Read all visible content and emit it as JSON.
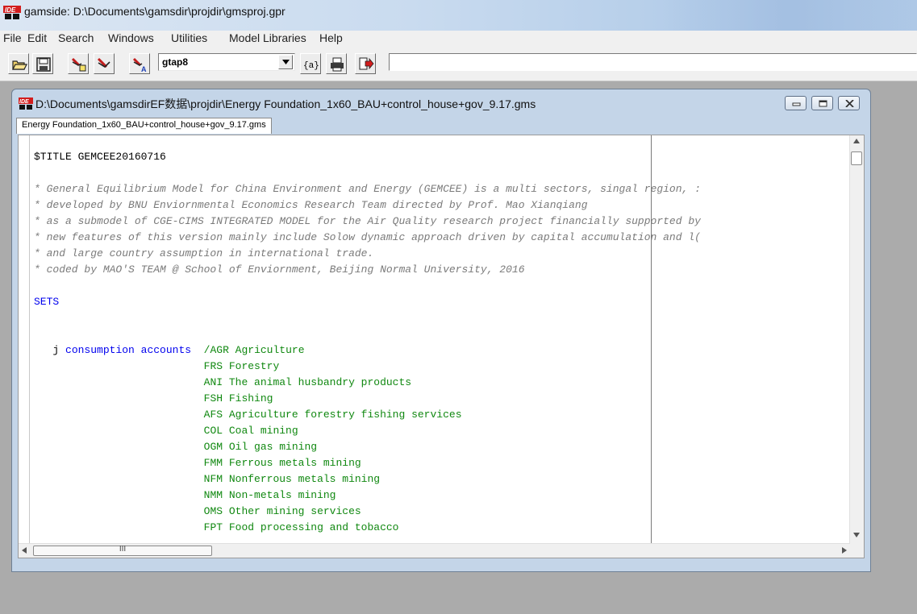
{
  "window": {
    "title": "gamside: D:\\Documents\\gamsdir\\projdir\\gmsproj.gpr"
  },
  "menu": [
    "File",
    "Edit",
    "Search",
    "Windows",
    "Utilities",
    "Model Libraries",
    "Help"
  ],
  "toolbar": {
    "model_combo_value": "gtap8",
    "command_value": "",
    "model_button_label": "{a}"
  },
  "document": {
    "title": "D:\\Documents\\gamsdirEF数据\\projdir\\Energy Foundation_1x60_BAU+control_house+gov_9.17.gms",
    "tab_label": "Energy Foundation_1x60_BAU+control_house+gov_9.17.gms"
  },
  "code": {
    "title_line": "$TITLE GEMCEE20160716",
    "comments": [
      "* General Equilibrium Model for China Environment and Energy (GEMCEE) is a multi sectors, singal region, :",
      "* developed by BNU Enviornmental Economics Research Team directed by Prof. Mao Xianqiang",
      "* as a submodel of CGE-CIMS INTEGRATED MODEL for the Air Quality research project financially supported by",
      "* new features of this version mainly include Solow dynamic approach driven by capital accumulation and l(",
      "* and large country assumption in international trade.",
      "* coded by MAO'S TEAM @ School of Enviornment, Beijing Normal University, 2016"
    ],
    "sets_keyword": "SETS",
    "set_name": "j",
    "set_desc": "consumption accounts",
    "elements": [
      "/AGR Agriculture",
      "FRS Forestry",
      "ANI The animal husbandry products",
      "FSH Fishing",
      "AFS Agriculture forestry fishing services",
      "COL Coal mining",
      "OGM Oil gas mining",
      "FMM Ferrous metals mining",
      "NFM Nonferrous metals mining",
      "NMM Non-metals mining",
      "OMS Other mining services",
      "FPT Food processing and tobacco"
    ]
  },
  "hscroll_grip": "III",
  "colors": {
    "keyword": "#0000ee",
    "comment": "#7a7a7a",
    "element": "#108810",
    "title_bar": "#c4d5e8"
  }
}
